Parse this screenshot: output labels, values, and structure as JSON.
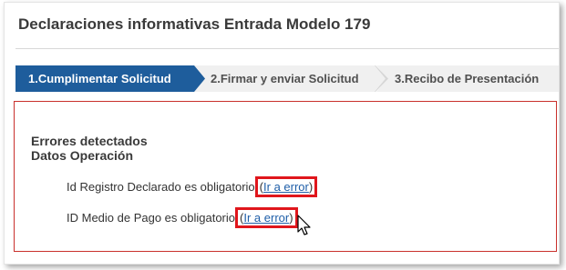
{
  "page": {
    "title": "Declaraciones informativas Entrada Modelo 179"
  },
  "steps": [
    {
      "label": "1.Cumplimentar Solicitud",
      "active": true
    },
    {
      "label": "2.Firmar y enviar Solicitud",
      "active": false
    },
    {
      "label": "3.Recibo de Presentación",
      "active": false
    }
  ],
  "errors": {
    "heading": "Errores detectados",
    "section": "Datos Operación",
    "items": [
      {
        "message": "Id Registro Declarado es obligatorio",
        "link_label": "Ir a error"
      },
      {
        "message": "ID Medio de Pago es obligatorio",
        "link_label": "Ir a error"
      }
    ]
  },
  "colors": {
    "active_step": "#1e5d9c",
    "inactive_step": "#f0f0f0",
    "error_border": "#c9302c",
    "highlight": "#e0161c",
    "link": "#1f5ea8"
  },
  "icons": {
    "cursor": "mouse-pointer-icon"
  }
}
